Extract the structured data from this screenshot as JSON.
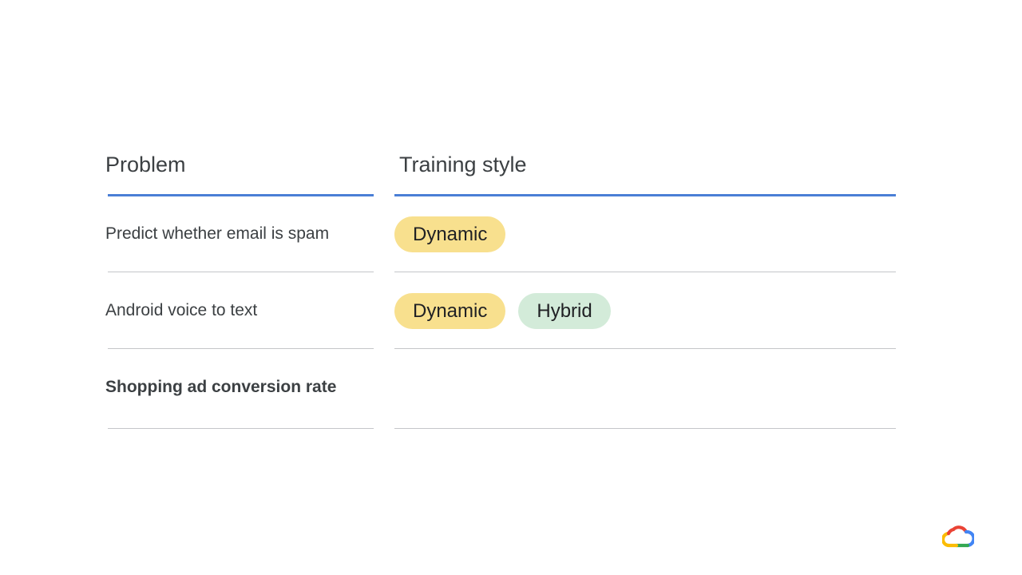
{
  "table": {
    "headers": {
      "problem": "Problem",
      "training_style": "Training style"
    },
    "rows": [
      {
        "problem": "Predict whether email is spam",
        "styles": [
          {
            "label": "Dynamic",
            "color": "#f8e08e"
          }
        ]
      },
      {
        "problem": "Android voice to text",
        "styles": [
          {
            "label": "Dynamic",
            "color": "#f8e08e"
          },
          {
            "label": "Hybrid",
            "color": "#d3ebd9"
          }
        ]
      },
      {
        "problem": "Shopping ad conversion rate",
        "styles": []
      }
    ]
  },
  "colors": {
    "header_rule": "#4a7fd6",
    "row_rule": "#c4c6c9",
    "dynamic_chip": "#f8e08e",
    "hybrid_chip": "#d3ebd9"
  },
  "logo": {
    "icon": "google-cloud-logo-icon"
  }
}
